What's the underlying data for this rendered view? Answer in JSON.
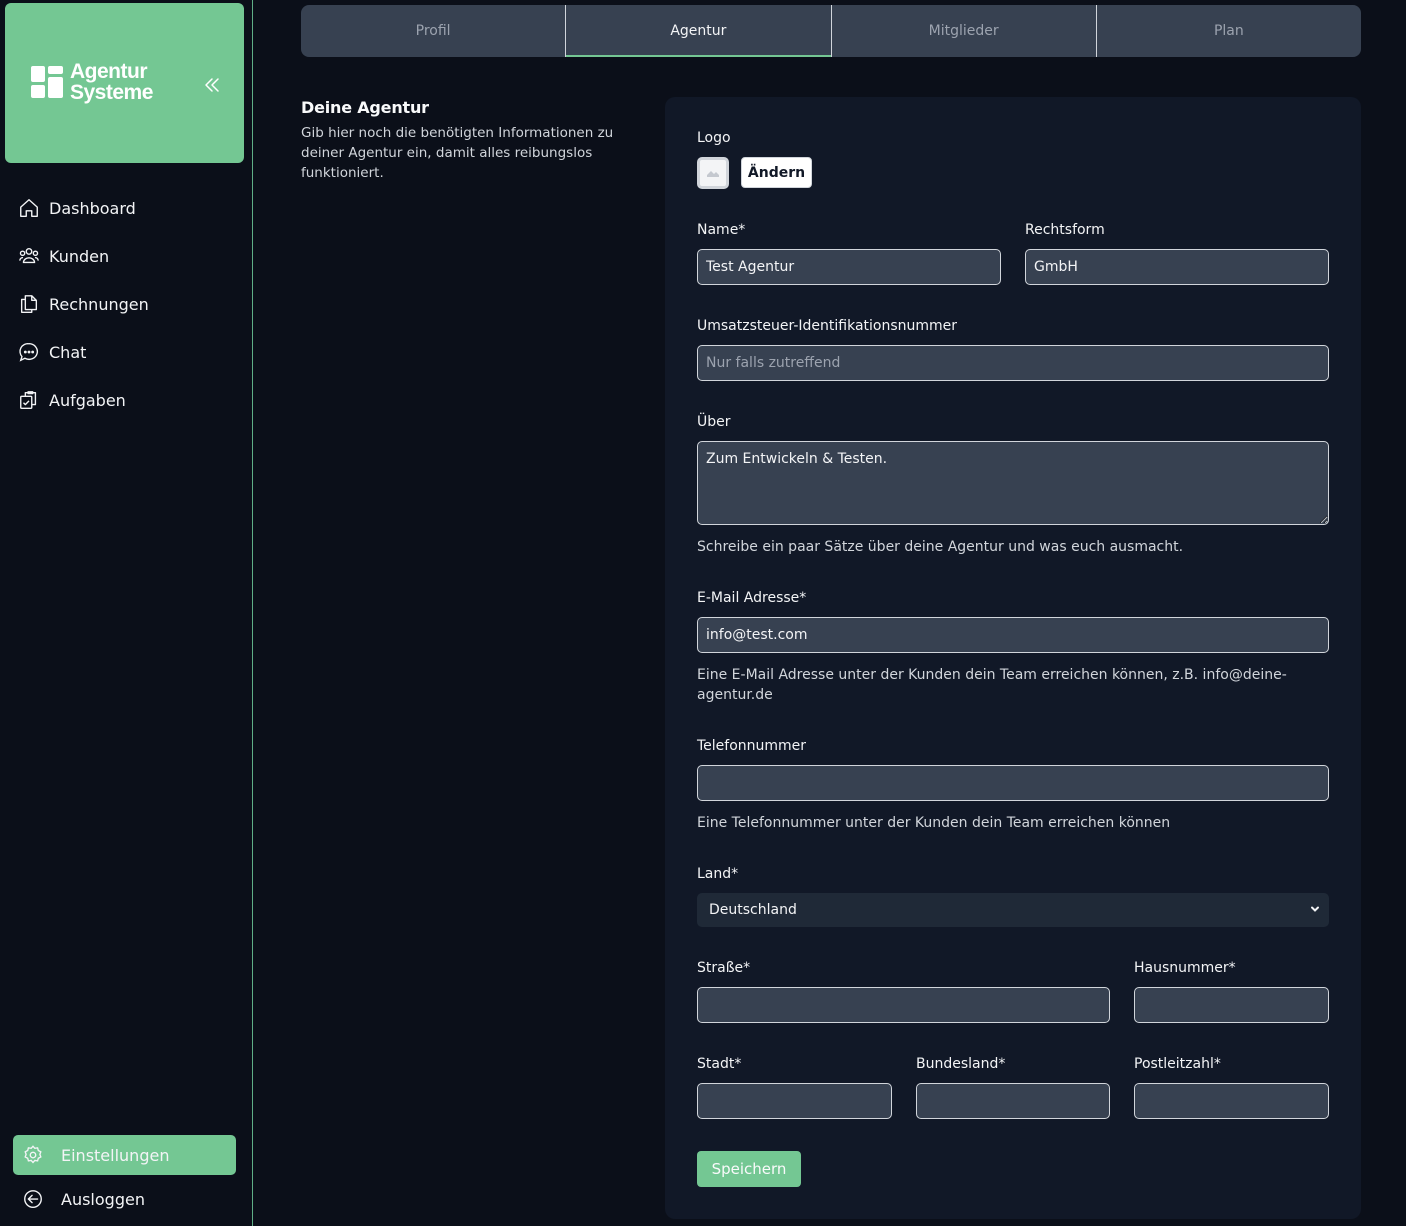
{
  "brand": {
    "line1": "Agentur",
    "line2": "Systeme",
    "collapse_icon": "chevrons-left-icon",
    "color": "#74c793"
  },
  "sidebar": {
    "items": [
      {
        "label": "Dashboard",
        "icon": "home-icon"
      },
      {
        "label": "Kunden",
        "icon": "users-icon"
      },
      {
        "label": "Rechnungen",
        "icon": "documents-icon"
      },
      {
        "label": "Chat",
        "icon": "chat-icon"
      },
      {
        "label": "Aufgaben",
        "icon": "clipboard-check-icon"
      }
    ],
    "bottom": [
      {
        "label": "Einstellungen",
        "icon": "gear-icon",
        "active": true
      },
      {
        "label": "Ausloggen",
        "icon": "logout-icon",
        "active": false
      }
    ]
  },
  "tabs": [
    {
      "label": "Profil",
      "active": false
    },
    {
      "label": "Agentur",
      "active": true
    },
    {
      "label": "Mitglieder",
      "active": false
    },
    {
      "label": "Plan",
      "active": false
    }
  ],
  "intro": {
    "title": "Deine Agentur",
    "description": "Gib hier noch die benötigten Informationen zu deiner Agentur ein, damit alles reibungslos funktioniert."
  },
  "form": {
    "logo": {
      "label": "Logo",
      "change_label": "Ändern"
    },
    "name": {
      "label": "Name*",
      "value": "Test Agentur"
    },
    "legal_form": {
      "label": "Rechtsform",
      "value": "GmbH"
    },
    "vat_id": {
      "label": "Umsatzsteuer-Identifikationsnummer",
      "value": "",
      "placeholder": "Nur falls zutreffend"
    },
    "about": {
      "label": "Über",
      "value": "Zum Entwickeln & Testen.",
      "help": "Schreibe ein paar Sätze über deine Agentur und was euch ausmacht."
    },
    "email": {
      "label": "E-Mail Adresse*",
      "value": "info@test.com",
      "help": "Eine E-Mail Adresse unter der Kunden dein Team erreichen können, z.B. info@deine-agentur.de"
    },
    "phone": {
      "label": "Telefonnummer",
      "value": "",
      "help": "Eine Telefonnummer unter der Kunden dein Team erreichen können"
    },
    "country": {
      "label": "Land*",
      "value": "Deutschland"
    },
    "street": {
      "label": "Straße*",
      "value": ""
    },
    "house_number": {
      "label": "Hausnummer*",
      "value": ""
    },
    "city": {
      "label": "Stadt*",
      "value": ""
    },
    "state": {
      "label": "Bundesland*",
      "value": ""
    },
    "zip": {
      "label": "Postleitzahl*",
      "value": ""
    },
    "save_label": "Speichern"
  }
}
